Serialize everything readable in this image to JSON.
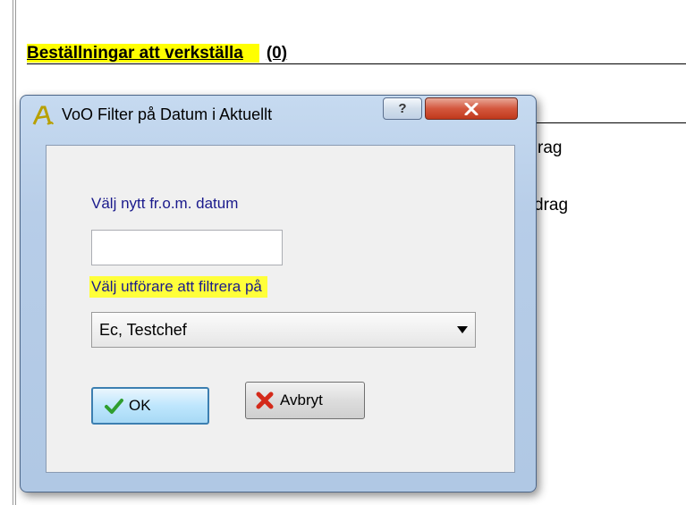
{
  "page": {
    "heading": "Beställningar att verkställa",
    "heading_count": "(0)",
    "bg_row1": "rag",
    "bg_row2": "drag",
    "bg_partial": "I"
  },
  "dialog": {
    "title": "VoO Filter på Datum i Aktuellt",
    "help_label": "?",
    "date_label": "Välj nytt fr.o.m. datum",
    "date_value": "",
    "performer_label": "Välj utförare att filtrera på",
    "performer_selected": "Ec, Testchef",
    "ok_label": "OK",
    "cancel_label": "Avbryt"
  },
  "colors": {
    "highlight": "#ffff00",
    "label_text": "#1a1a8c",
    "close_button": "#c0391c"
  },
  "icons": {
    "app": "app-logo-icon",
    "ok": "checkmark-icon",
    "cancel": "red-x-icon",
    "close": "close-icon",
    "help": "help-icon"
  }
}
